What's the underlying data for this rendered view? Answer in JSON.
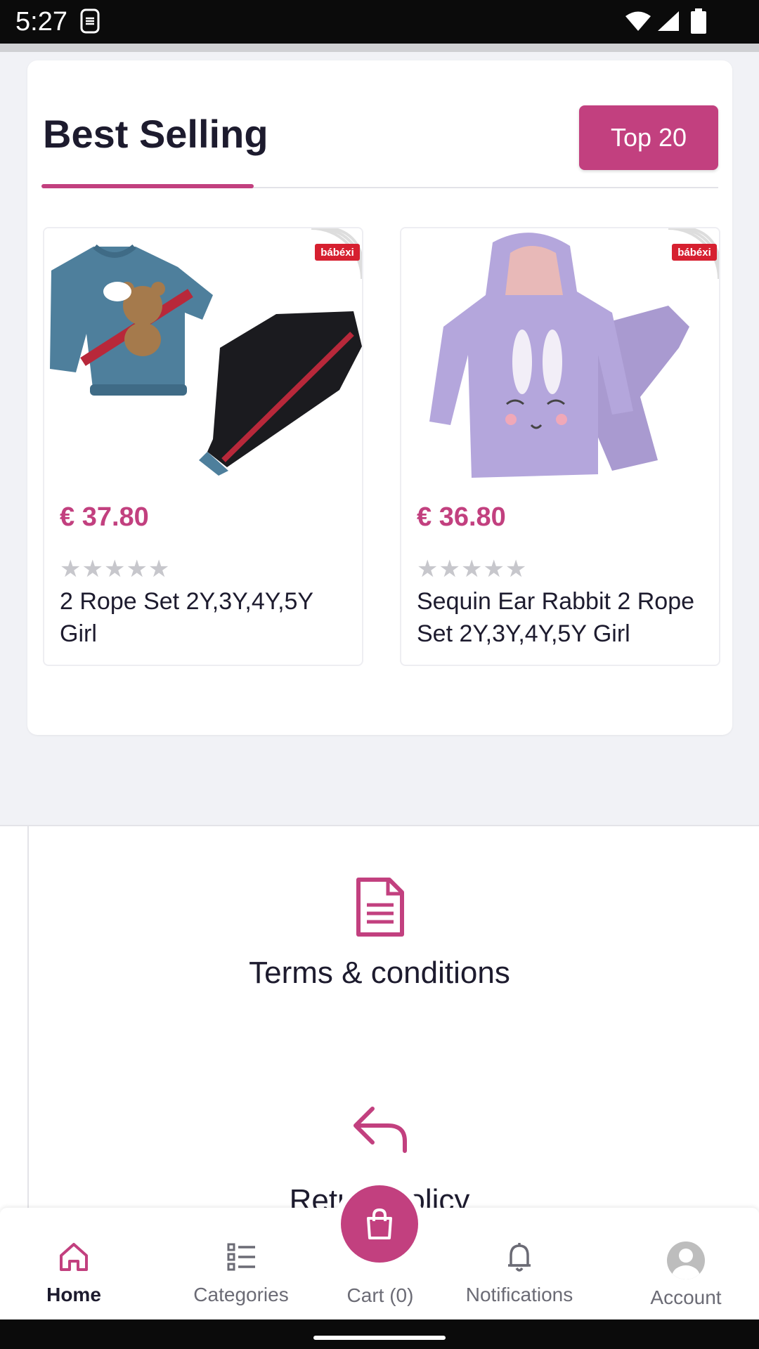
{
  "status_bar": {
    "time": "5:27"
  },
  "best_selling": {
    "title": "Best Selling",
    "top_button": "Top 20",
    "products": [
      {
        "brand": "bábéxi",
        "price": "€ 37.80",
        "stars": "★★★★★",
        "name": "2 Rope Set 2Y,3Y,4Y,5Y Girl"
      },
      {
        "brand": "bábéxi",
        "price": "€ 36.80",
        "stars": "★★★★★",
        "name": "Sequin Ear Rabbit 2 Rope Set 2Y,3Y,4Y,5Y Girl"
      }
    ]
  },
  "info": {
    "terms_label": "Terms & conditions",
    "return_label": "Return policy"
  },
  "bottom_nav": {
    "home": "Home",
    "categories": "Categories",
    "cart": "Cart (0)",
    "notifications": "Notifications",
    "account": "Account"
  },
  "colors": {
    "accent": "#c2407f",
    "text": "#1d1b2e",
    "muted": "#6b6b75"
  },
  "icons": [
    "sim-icon",
    "wifi-icon",
    "signal-icon",
    "battery-icon",
    "document-icon",
    "return-arrow-icon",
    "home-icon",
    "categories-icon",
    "shopping-bag-icon",
    "bell-icon",
    "avatar"
  ]
}
